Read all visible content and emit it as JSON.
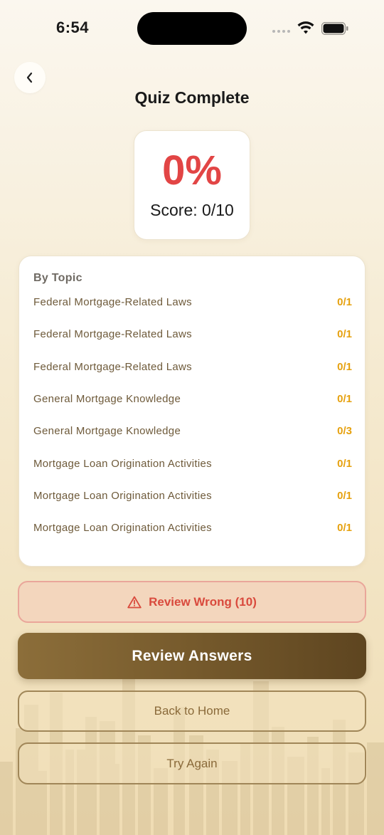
{
  "status_bar": {
    "time": "6:54"
  },
  "header": {
    "title": "Quiz Complete"
  },
  "score": {
    "percent": "0%",
    "text": "Score: 0/10"
  },
  "topics": {
    "heading": "By Topic",
    "items": [
      {
        "name": "Federal Mortgage-Related Laws",
        "score": "0/1"
      },
      {
        "name": "Federal Mortgage-Related Laws",
        "score": "0/1"
      },
      {
        "name": "Federal Mortgage-Related Laws",
        "score": "0/1"
      },
      {
        "name": "General Mortgage Knowledge",
        "score": "0/1"
      },
      {
        "name": "General Mortgage Knowledge",
        "score": "0/3"
      },
      {
        "name": "Mortgage Loan Origination Activities",
        "score": "0/1"
      },
      {
        "name": "Mortgage Loan Origination Activities",
        "score": "0/1"
      },
      {
        "name": "Mortgage Loan Origination Activities",
        "score": "0/1"
      }
    ]
  },
  "actions": {
    "review_wrong": "Review Wrong (10)",
    "review_answers": "Review Answers",
    "back_home": "Back to Home",
    "try_again": "Try Again"
  },
  "icons": {
    "back": "chevron-left-icon",
    "warning": "warning-triangle-icon",
    "wifi": "wifi-icon",
    "battery": "battery-icon",
    "signal": "signal-icon"
  },
  "colors": {
    "score_red": "#e24545",
    "topic_score_amber": "#e6a10f",
    "primary_brown": "#765a2c",
    "warning_red": "#d94a3d"
  }
}
